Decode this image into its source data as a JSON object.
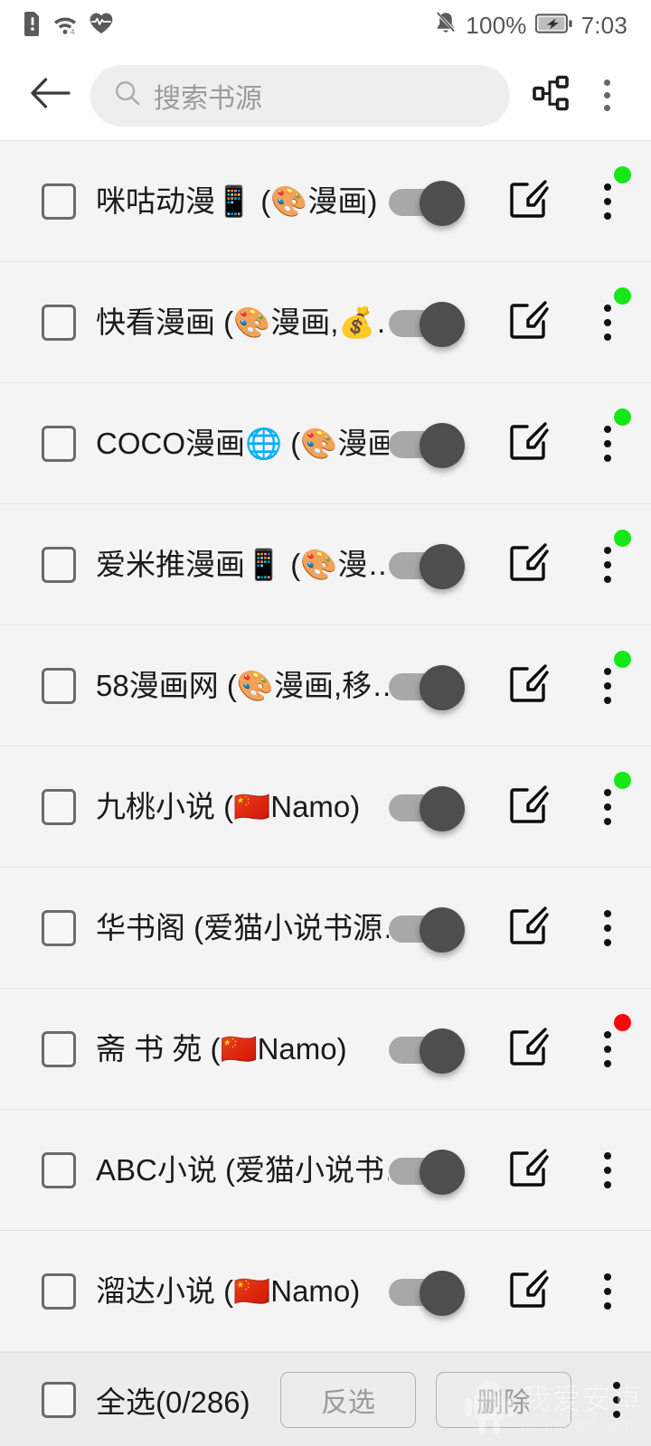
{
  "status_bar": {
    "icons_left": [
      "sim-alert-icon",
      "wifi-icon",
      "health-heart-icon"
    ],
    "mute_icon": "bell-muted-icon",
    "battery_percent": "100%",
    "battery_icon": "battery-charging-icon",
    "time": "7:03"
  },
  "app_bar": {
    "back_icon": "back-arrow-icon",
    "search": {
      "icon": "search-icon",
      "value": "",
      "placeholder": "搜索书源"
    },
    "group_icon": "source-group-icon",
    "overflow_icon": "overflow-menu-icon"
  },
  "colors": {
    "status_ok": "#16e716",
    "status_error": "#f40a0a",
    "toggle_track": "#a8a8a8",
    "toggle_thumb": "#4e4e4e",
    "row_bg": "#f4f4f4",
    "bottom_bg": "#ececec"
  },
  "rows": [
    {
      "title": "咪咕动漫📱 (🎨漫画)",
      "enabled": true,
      "status": "green",
      "checked": false
    },
    {
      "title": "快看漫画 (🎨漫画,💰…",
      "enabled": true,
      "status": "green",
      "checked": false
    },
    {
      "title": "COCO漫画🌐 (🎨漫画)",
      "enabled": true,
      "status": "green",
      "checked": false
    },
    {
      "title": "爱米推漫画📱 (🎨漫…",
      "enabled": true,
      "status": "green",
      "checked": false
    },
    {
      "title": "58漫画网 (🎨漫画,移…",
      "enabled": true,
      "status": "green",
      "checked": false
    },
    {
      "title": "九桃小说 (🇨🇳Namo)",
      "enabled": true,
      "status": "green",
      "checked": false
    },
    {
      "title": "华书阁 (爱猫小说书源…",
      "enabled": true,
      "status": "none",
      "checked": false
    },
    {
      "title": "斋 书 苑 (🇨🇳Namo)",
      "enabled": true,
      "status": "red",
      "checked": false
    },
    {
      "title": "ABC小说 (爱猫小说书…",
      "enabled": true,
      "status": "none",
      "checked": false
    },
    {
      "title": "溜达小说 (🇨🇳Namo)",
      "enabled": true,
      "status": "none",
      "checked": false
    }
  ],
  "bottom_bar": {
    "select_all_label": "全选(0/286)",
    "select_all_checked": false,
    "invert_label": "反选",
    "delete_label": "删除",
    "overflow_icon": "overflow-menu-icon"
  },
  "watermark": {
    "main": "我爱安卓",
    "sub": "52android.com",
    "logo": "android-mascot-icon"
  }
}
